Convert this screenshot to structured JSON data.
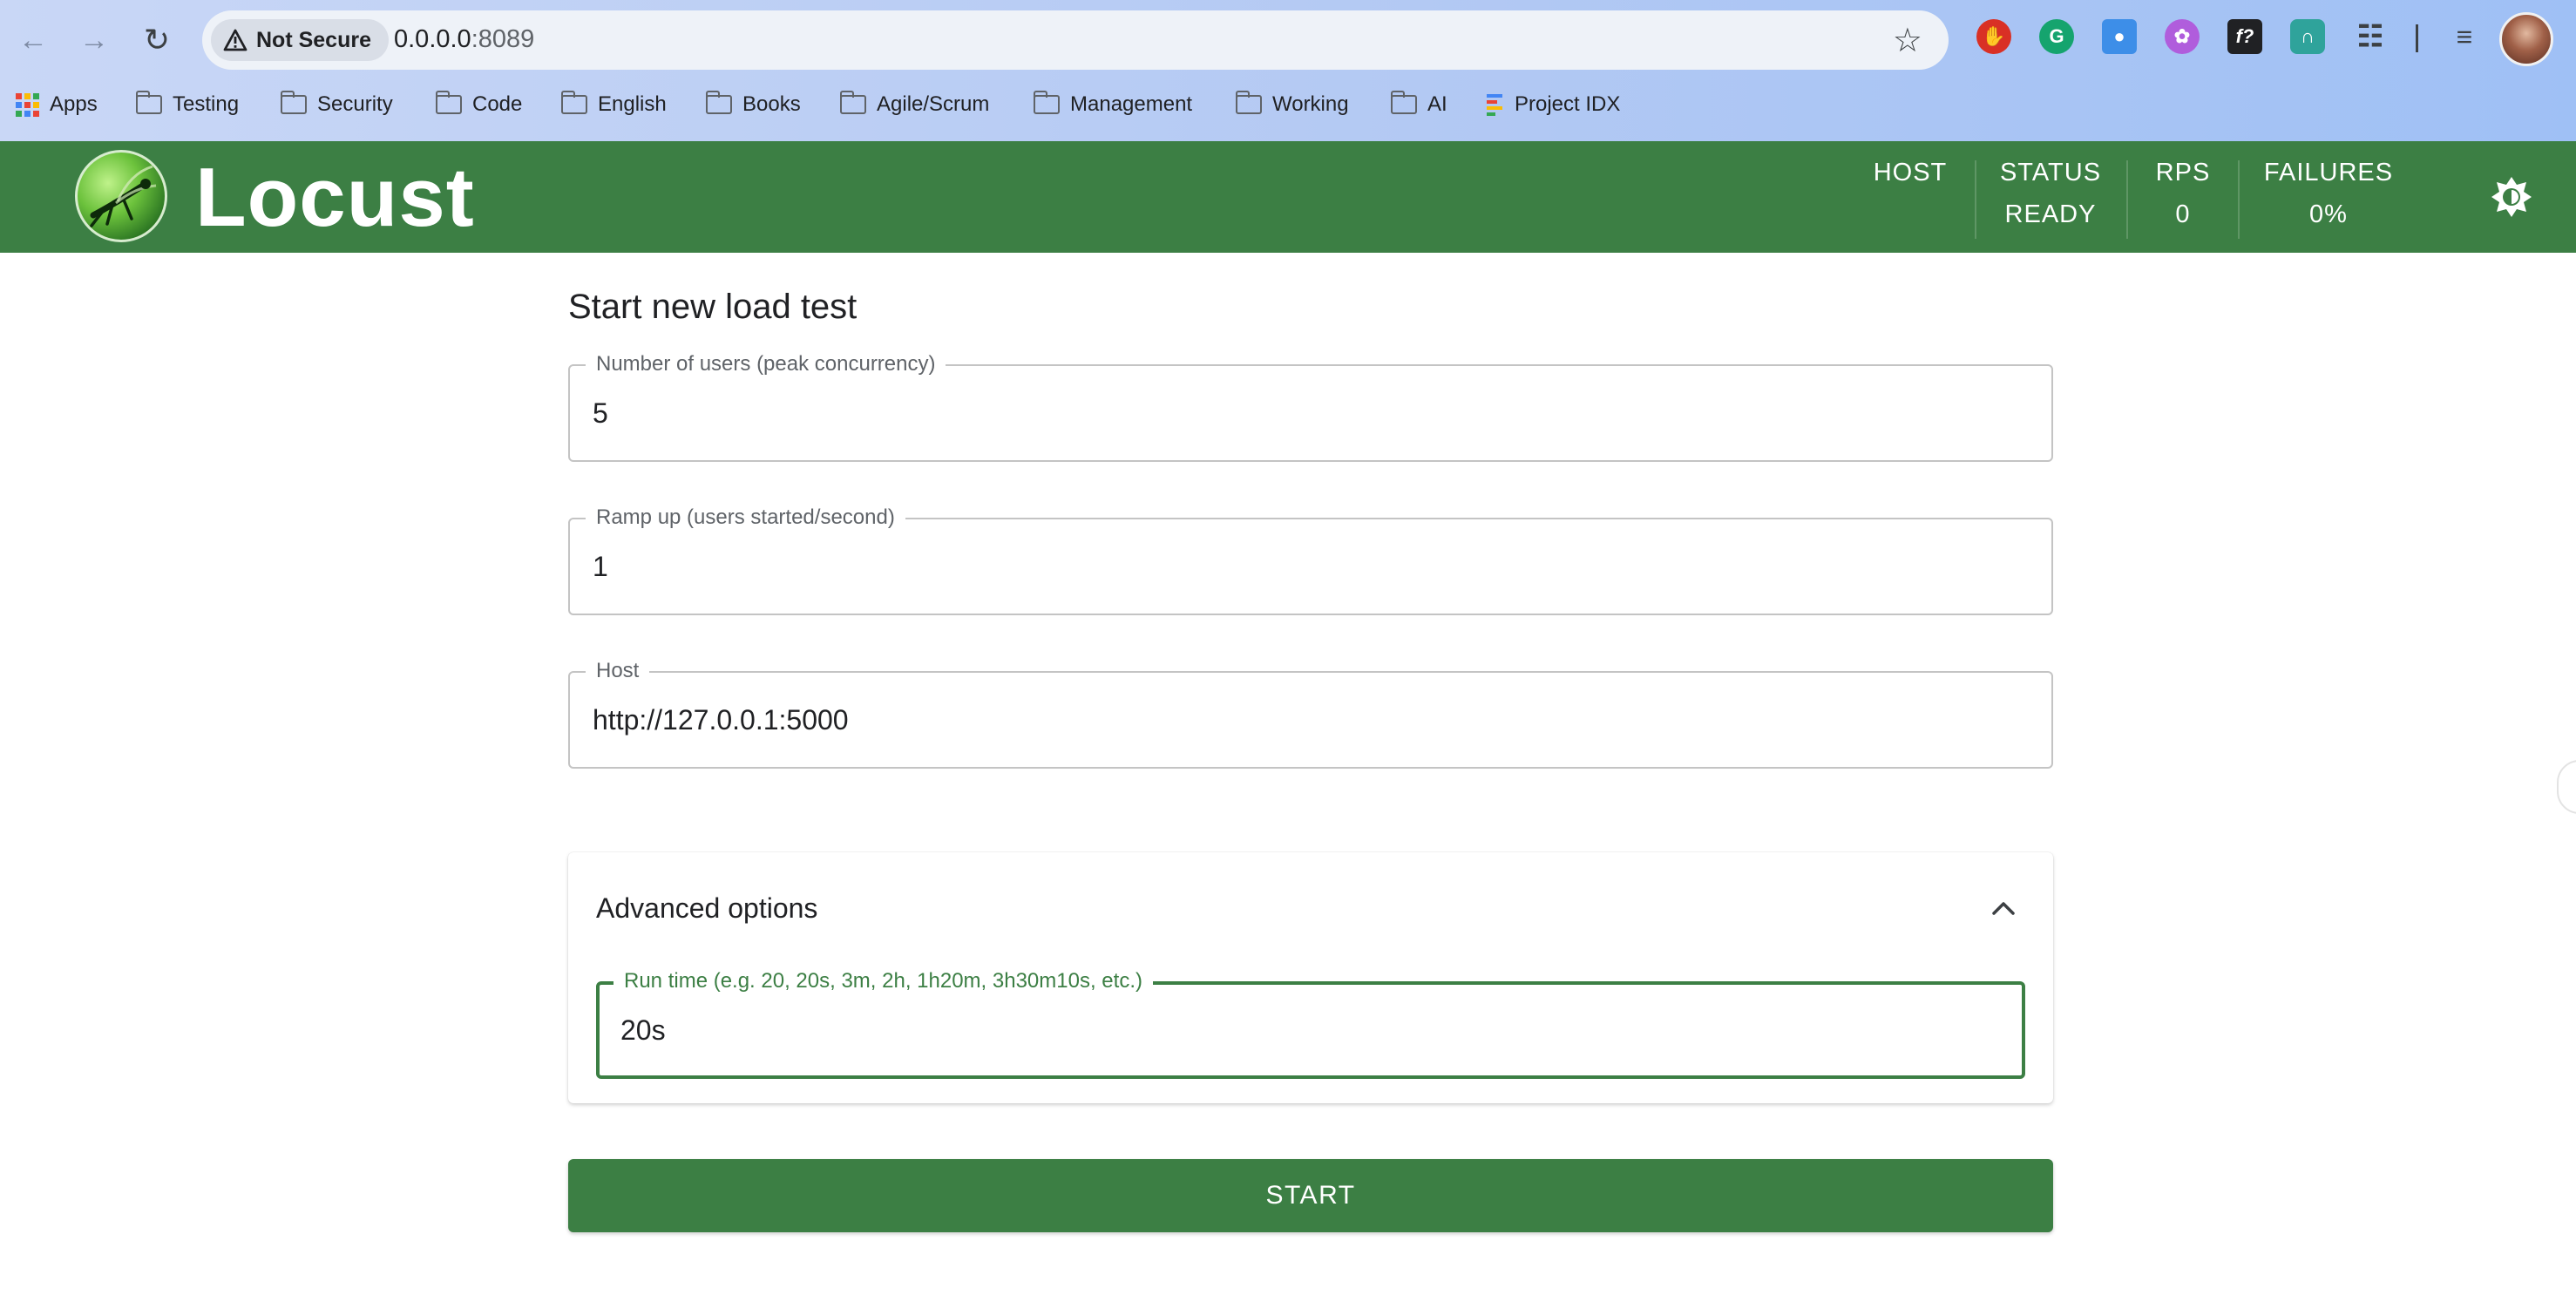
{
  "browser": {
    "security_chip": "Not Secure",
    "url_host": "0.0.0.0",
    "url_port": ":8089",
    "bookmarks": [
      "Apps",
      "Testing",
      "Security",
      "Code",
      "English",
      "Books",
      "Agile/Scrum",
      "Management",
      "Working",
      "AI",
      "Project IDX"
    ]
  },
  "header": {
    "brand": "Locust",
    "stats": [
      {
        "label": "HOST",
        "value": ""
      },
      {
        "label": "STATUS",
        "value": "READY"
      },
      {
        "label": "RPS",
        "value": "0"
      },
      {
        "label": "FAILURES",
        "value": "0%"
      }
    ]
  },
  "form": {
    "title": "Start new load test",
    "users_label": "Number of users (peak concurrency)",
    "users_value": "5",
    "ramp_label": "Ramp up (users started/second)",
    "ramp_value": "1",
    "host_label": "Host",
    "host_value": "http://127.0.0.1:5000",
    "advanced_title": "Advanced options",
    "runtime_label": "Run time (e.g. 20, 20s, 3m, 2h, 1h20m, 3h30m10s, etc.)",
    "runtime_value": "20s",
    "start_label": "START"
  },
  "colors": {
    "brand_green": "#3c7f44",
    "chrome_bg": "#b3c9f3"
  }
}
